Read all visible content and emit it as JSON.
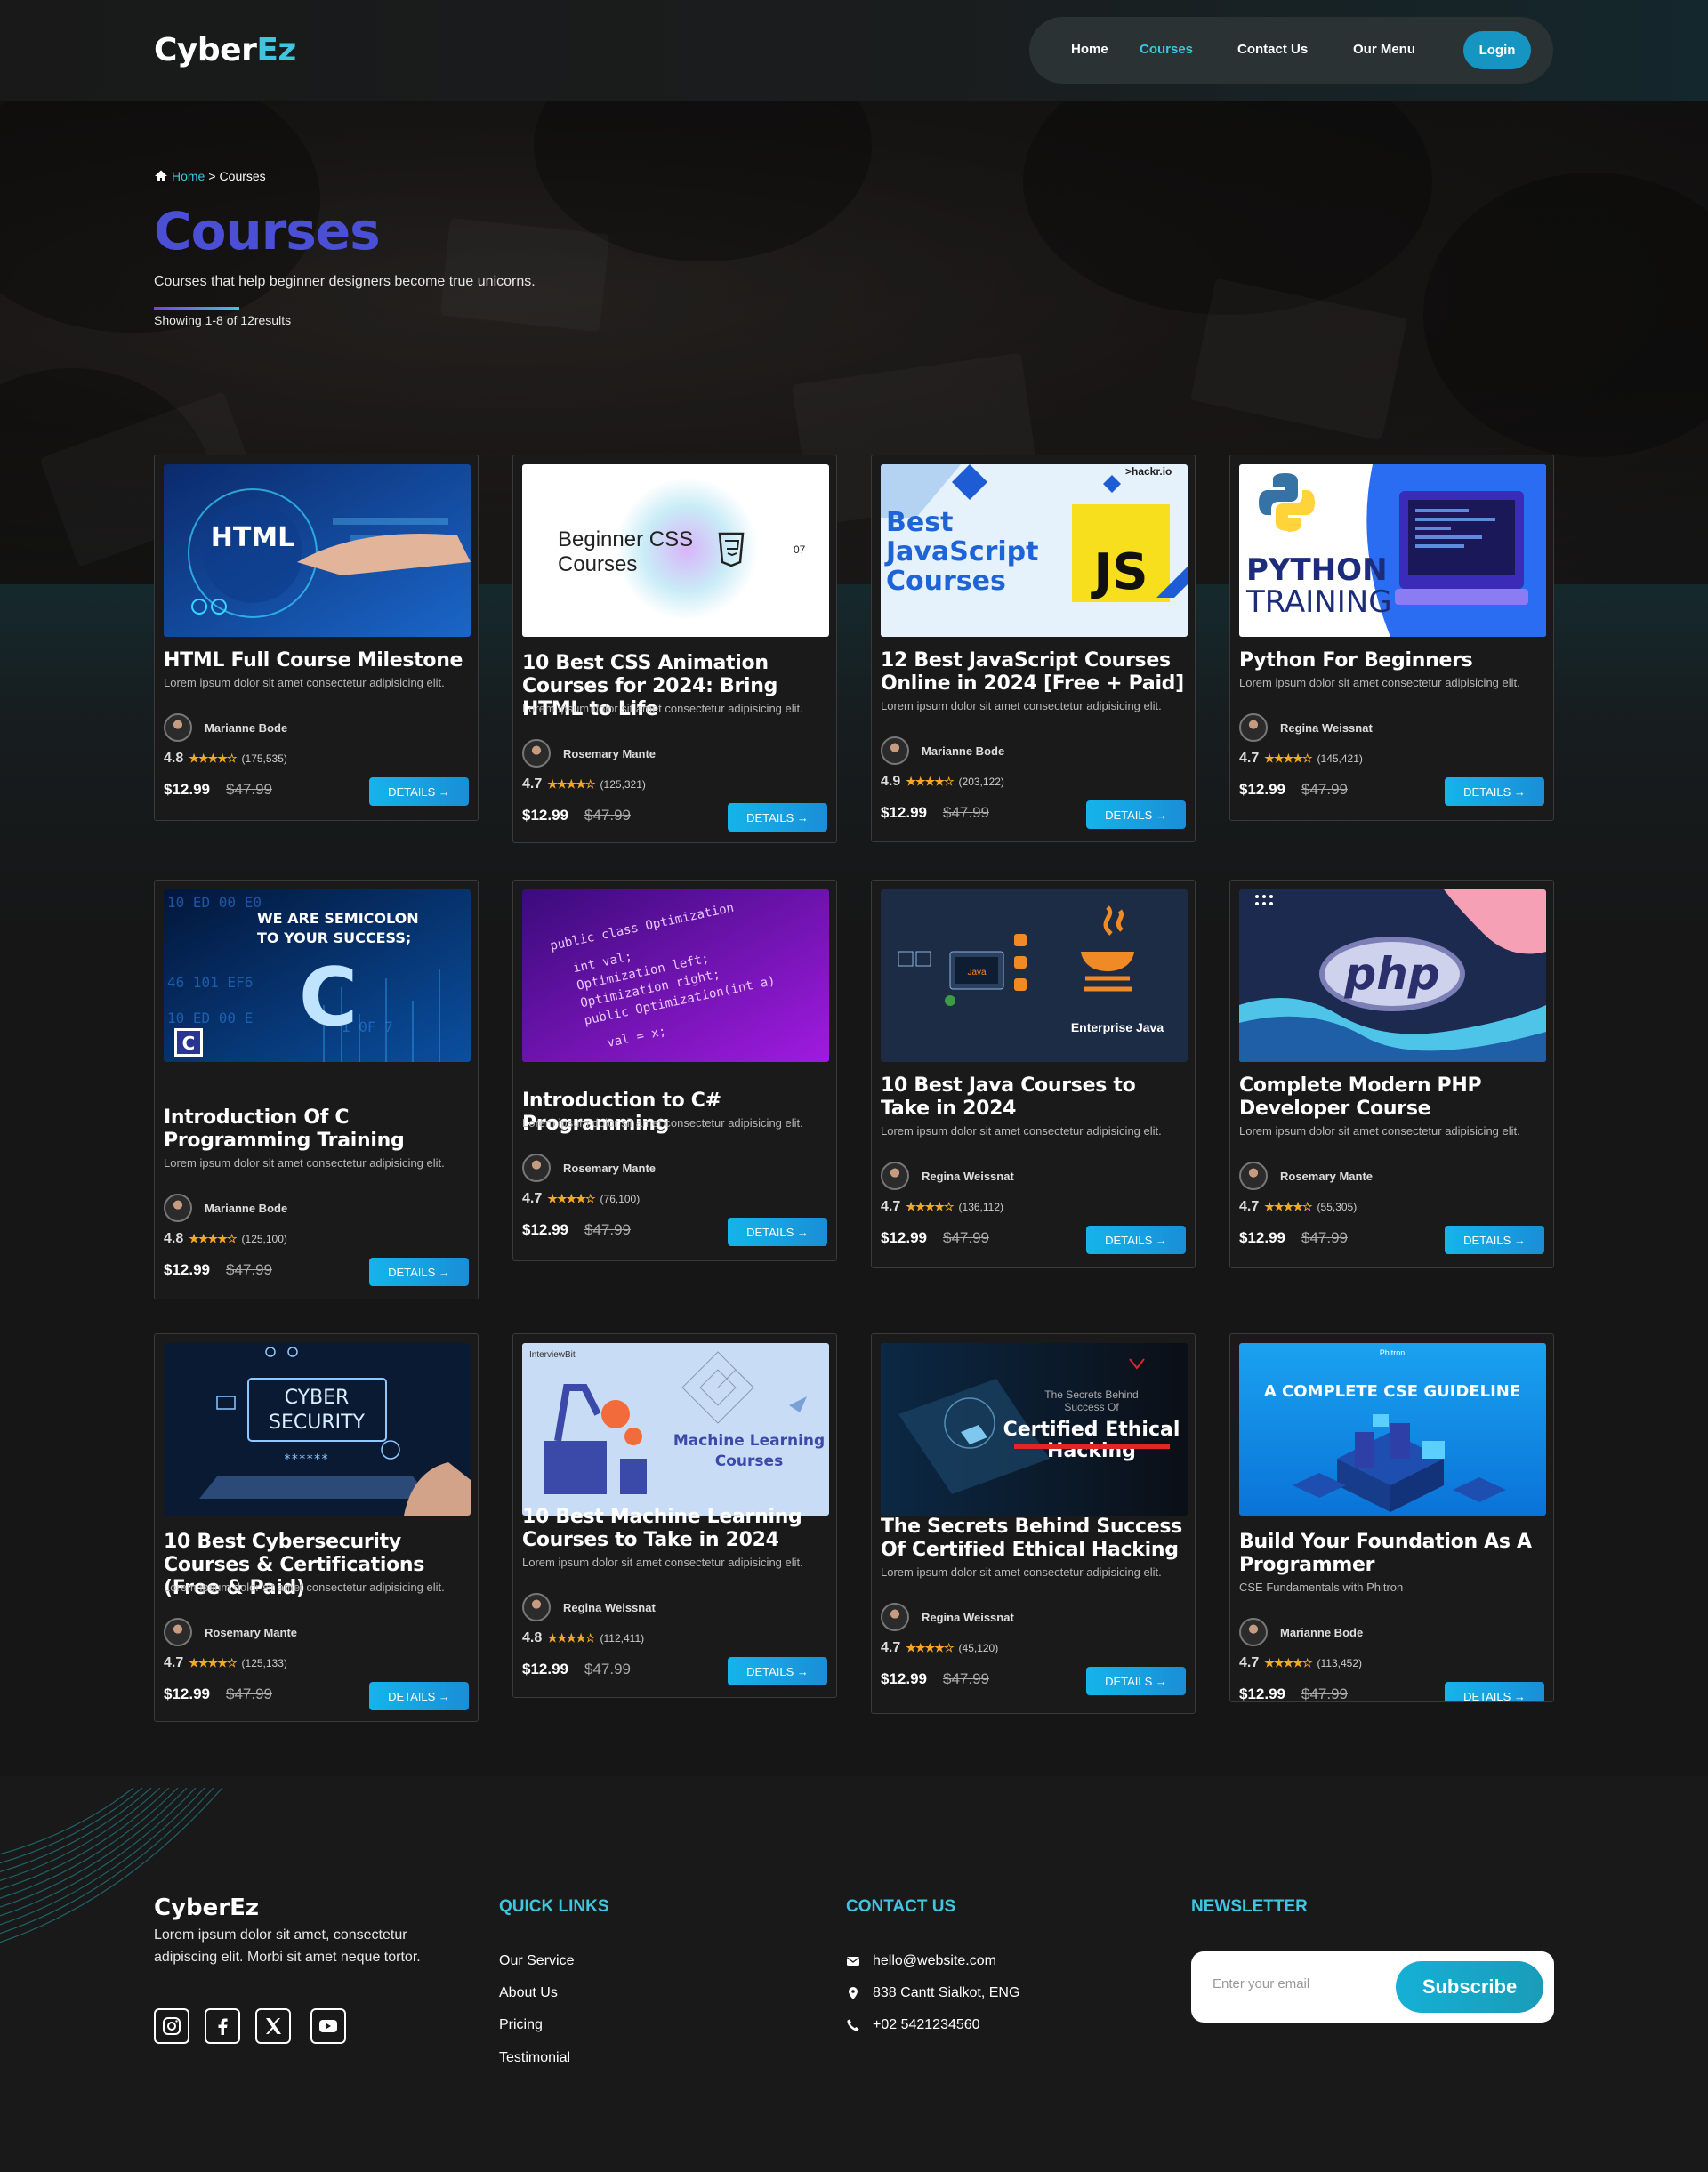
{
  "header": {
    "logo_main": "Cyber",
    "logo_accent": "Ez",
    "nav": [
      "Home",
      "Courses",
      "Contact Us",
      "Our Menu"
    ],
    "login": "Login"
  },
  "hero": {
    "breadcrumb_home": "Home",
    "breadcrumb_sep": ">",
    "breadcrumb_current": "Courses",
    "title": "Courses",
    "subtitle": "Courses that help beginner designers become true unicorns.",
    "showing": "Showing 1-8 of 12results"
  },
  "courses": [
    {
      "title": "HTML Full Course Milestone",
      "desc": "Lorem ipsum dolor sit amet consectetur adipisicing elit.",
      "author": "Marianne Bode",
      "rating": "4.8",
      "stars": "★★★★☆",
      "count": "(175,535)",
      "price": "$12.99",
      "old_price": "$47.99",
      "button": "DETAILS →",
      "thumb_text": [
        "HTML"
      ]
    },
    {
      "title": "10 Best CSS Animation Courses for 2024: Bring HTML to Life",
      "desc": "Lorem ipsum dolor sit amet consectetur adipisicing elit.",
      "author": "Rosemary Mante",
      "rating": "4.7",
      "stars": "★★★★☆",
      "count": "(125,321)",
      "price": "$12.99",
      "old_price": "$47.99",
      "button": "DETAILS →",
      "thumb_text": [
        "Beginner CSS",
        "Courses",
        "07"
      ]
    },
    {
      "title": "12 Best JavaScript Courses Online in 2024 [Free + Paid]",
      "desc": "Lorem ipsum dolor sit amet consectetur adipisicing elit.",
      "author": "Marianne Bode",
      "rating": "4.9",
      "stars": "★★★★☆",
      "count": "(203,122)",
      "price": "$12.99",
      "old_price": "$47.99",
      "button": "DETAILS →",
      "thumb_text": [
        "Best",
        "JavaScript",
        "Courses",
        "JS",
        ">hackr.io"
      ]
    },
    {
      "title": "Python For Beginners",
      "desc": "Lorem ipsum dolor sit amet consectetur adipisicing elit.",
      "author": "Regina Weissnat",
      "rating": "4.7",
      "stars": "★★★★☆",
      "count": "(145,421)",
      "price": "$12.99",
      "old_price": "$47.99",
      "button": "DETAILS →",
      "thumb_text": [
        "PYTHON",
        "TRAINING"
      ]
    },
    {
      "title": "Introduction Of C Programming Training",
      "desc": "Lorem ipsum dolor sit amet consectetur adipisicing elit.",
      "author": "Marianne Bode",
      "rating": "4.8",
      "stars": "★★★★☆",
      "count": "(125,100)",
      "price": "$12.99",
      "old_price": "$47.99",
      "button": "DETAILS →",
      "thumb_text": [
        "WE ARE SEMICOLON",
        "TO YOUR SUCCESS;",
        "C"
      ]
    },
    {
      "title": "Introduction to C# Programming",
      "desc": "Lorem ipsum dolor sit amet consectetur adipisicing elit.",
      "author": "Rosemary Mante",
      "rating": "4.7",
      "stars": "★★★★☆",
      "count": "(76,100)",
      "price": "$12.99",
      "old_price": "$47.99",
      "button": "DETAILS →",
      "thumb_text": [
        "public class Optimization",
        "int val;",
        "Optimization left;",
        "Optimization right;",
        "public Optimization(int a)",
        "val = x;"
      ]
    },
    {
      "title": "10 Best Java Courses to Take in 2024",
      "desc": "Lorem ipsum dolor sit amet consectetur adipisicing elit.",
      "author": "Regina Weissnat",
      "rating": "4.7",
      "stars": "★★★★☆",
      "count": "(136,112)",
      "price": "$12.99",
      "old_price": "$47.99",
      "button": "DETAILS →",
      "thumb_text": [
        "Enterprise Java",
        "Java"
      ]
    },
    {
      "title": "Complete Modern PHP Developer Course",
      "desc": "Lorem ipsum dolor sit amet consectetur adipisicing elit.",
      "author": "Rosemary Mante",
      "rating": "4.7",
      "stars": "★★★★☆",
      "count": "(55,305)",
      "price": "$12.99",
      "old_price": "$47.99",
      "button": "DETAILS →",
      "thumb_text": [
        "php"
      ]
    },
    {
      "title": "10 Best Cybersecurity Courses & Certifications (Free & Paid)",
      "desc": "Lorem ipsum dolor sit amet consectetur adipisicing elit.",
      "author": "Rosemary Mante",
      "rating": "4.7",
      "stars": "★★★★☆",
      "count": "(125,133)",
      "price": "$12.99",
      "old_price": "$47.99",
      "button": "DETAILS →",
      "thumb_text": [
        "CYBER",
        "SECURITY",
        "******"
      ]
    },
    {
      "title": "10 Best Machine Learning Courses to Take in 2024",
      "desc": "Lorem ipsum dolor sit amet consectetur adipisicing elit.",
      "author": "Regina Weissnat",
      "rating": "4.8",
      "stars": "★★★★☆",
      "count": "(112,411)",
      "price": "$12.99",
      "old_price": "$47.99",
      "button": "DETAILS →",
      "thumb_text": [
        "InterviewBit",
        "Machine Learning",
        "Courses"
      ]
    },
    {
      "title": "The Secrets Behind Success Of Certified Ethical Hacking",
      "desc": "Lorem ipsum dolor sit amet consectetur adipisicing elit.",
      "author": "Regina Weissnat",
      "rating": "4.7",
      "stars": "★★★★☆",
      "count": "(45,120)",
      "price": "$12.99",
      "old_price": "$47.99",
      "button": "DETAILS →",
      "thumb_text": [
        "The Secrets Behind",
        "Success Of",
        "Certified Ethical",
        "Hacking"
      ]
    },
    {
      "title": "Build Your Foundation As A Programmer",
      "desc": "CSE Fundamentals with Phitron",
      "author": "Marianne Bode",
      "rating": "4.7",
      "stars": "★★★★☆",
      "count": "(113,452)",
      "price": "$12.99",
      "old_price": "$47.99",
      "button": "DETAILS →",
      "thumb_text": [
        "A COMPLETE CSE GUIDELINE",
        "Phitron"
      ]
    }
  ],
  "footer": {
    "brand": "CyberEz",
    "about": "Lorem ipsum dolor sit amet, consectetur adipiscing elit. Morbi sit amet neque tortor.",
    "social_icons": [
      "instagram-icon",
      "facebook-icon",
      "x-icon",
      "youtube-icon"
    ],
    "quick_links_title": "QUICK LINKS",
    "quick_links": [
      "Our Service",
      "About Us",
      "Pricing",
      "Testimonial"
    ],
    "contact_title": "CONTACT US",
    "contact": [
      {
        "icon": "mail-icon",
        "text": "hello@website.com"
      },
      {
        "icon": "location-icon",
        "text": "838 Cantt Sialkot, ENG"
      },
      {
        "icon": "phone-icon",
        "text": "+02 5421234560"
      }
    ],
    "newsletter_title": "NEWSLETTER",
    "email_placeholder": "Enter your email",
    "subscribe": "Subscribe"
  },
  "colors": {
    "accent": "#3ec6e0",
    "title": "#4b4fd6",
    "button": "#15b4ea",
    "star": "#f5a623"
  }
}
